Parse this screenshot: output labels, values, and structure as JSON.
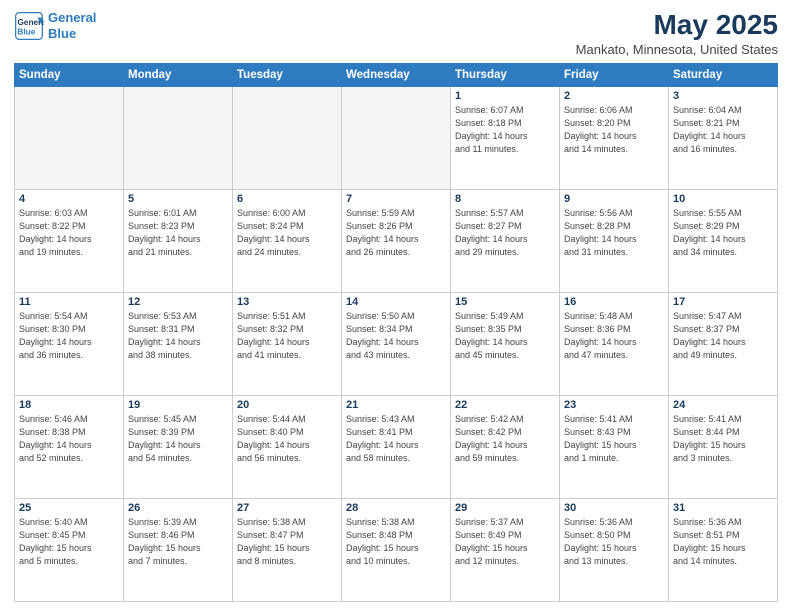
{
  "logo": {
    "line1": "General",
    "line2": "Blue"
  },
  "header": {
    "title": "May 2025",
    "subtitle": "Mankato, Minnesota, United States"
  },
  "weekdays": [
    "Sunday",
    "Monday",
    "Tuesday",
    "Wednesday",
    "Thursday",
    "Friday",
    "Saturday"
  ],
  "weeks": [
    [
      {
        "day": "",
        "info": ""
      },
      {
        "day": "",
        "info": ""
      },
      {
        "day": "",
        "info": ""
      },
      {
        "day": "",
        "info": ""
      },
      {
        "day": "1",
        "info": "Sunrise: 6:07 AM\nSunset: 8:18 PM\nDaylight: 14 hours\nand 11 minutes."
      },
      {
        "day": "2",
        "info": "Sunrise: 6:06 AM\nSunset: 8:20 PM\nDaylight: 14 hours\nand 14 minutes."
      },
      {
        "day": "3",
        "info": "Sunrise: 6:04 AM\nSunset: 8:21 PM\nDaylight: 14 hours\nand 16 minutes."
      }
    ],
    [
      {
        "day": "4",
        "info": "Sunrise: 6:03 AM\nSunset: 8:22 PM\nDaylight: 14 hours\nand 19 minutes."
      },
      {
        "day": "5",
        "info": "Sunrise: 6:01 AM\nSunset: 8:23 PM\nDaylight: 14 hours\nand 21 minutes."
      },
      {
        "day": "6",
        "info": "Sunrise: 6:00 AM\nSunset: 8:24 PM\nDaylight: 14 hours\nand 24 minutes."
      },
      {
        "day": "7",
        "info": "Sunrise: 5:59 AM\nSunset: 8:26 PM\nDaylight: 14 hours\nand 26 minutes."
      },
      {
        "day": "8",
        "info": "Sunrise: 5:57 AM\nSunset: 8:27 PM\nDaylight: 14 hours\nand 29 minutes."
      },
      {
        "day": "9",
        "info": "Sunrise: 5:56 AM\nSunset: 8:28 PM\nDaylight: 14 hours\nand 31 minutes."
      },
      {
        "day": "10",
        "info": "Sunrise: 5:55 AM\nSunset: 8:29 PM\nDaylight: 14 hours\nand 34 minutes."
      }
    ],
    [
      {
        "day": "11",
        "info": "Sunrise: 5:54 AM\nSunset: 8:30 PM\nDaylight: 14 hours\nand 36 minutes."
      },
      {
        "day": "12",
        "info": "Sunrise: 5:53 AM\nSunset: 8:31 PM\nDaylight: 14 hours\nand 38 minutes."
      },
      {
        "day": "13",
        "info": "Sunrise: 5:51 AM\nSunset: 8:32 PM\nDaylight: 14 hours\nand 41 minutes."
      },
      {
        "day": "14",
        "info": "Sunrise: 5:50 AM\nSunset: 8:34 PM\nDaylight: 14 hours\nand 43 minutes."
      },
      {
        "day": "15",
        "info": "Sunrise: 5:49 AM\nSunset: 8:35 PM\nDaylight: 14 hours\nand 45 minutes."
      },
      {
        "day": "16",
        "info": "Sunrise: 5:48 AM\nSunset: 8:36 PM\nDaylight: 14 hours\nand 47 minutes."
      },
      {
        "day": "17",
        "info": "Sunrise: 5:47 AM\nSunset: 8:37 PM\nDaylight: 14 hours\nand 49 minutes."
      }
    ],
    [
      {
        "day": "18",
        "info": "Sunrise: 5:46 AM\nSunset: 8:38 PM\nDaylight: 14 hours\nand 52 minutes."
      },
      {
        "day": "19",
        "info": "Sunrise: 5:45 AM\nSunset: 8:39 PM\nDaylight: 14 hours\nand 54 minutes."
      },
      {
        "day": "20",
        "info": "Sunrise: 5:44 AM\nSunset: 8:40 PM\nDaylight: 14 hours\nand 56 minutes."
      },
      {
        "day": "21",
        "info": "Sunrise: 5:43 AM\nSunset: 8:41 PM\nDaylight: 14 hours\nand 58 minutes."
      },
      {
        "day": "22",
        "info": "Sunrise: 5:42 AM\nSunset: 8:42 PM\nDaylight: 14 hours\nand 59 minutes."
      },
      {
        "day": "23",
        "info": "Sunrise: 5:41 AM\nSunset: 8:43 PM\nDaylight: 15 hours\nand 1 minute."
      },
      {
        "day": "24",
        "info": "Sunrise: 5:41 AM\nSunset: 8:44 PM\nDaylight: 15 hours\nand 3 minutes."
      }
    ],
    [
      {
        "day": "25",
        "info": "Sunrise: 5:40 AM\nSunset: 8:45 PM\nDaylight: 15 hours\nand 5 minutes."
      },
      {
        "day": "26",
        "info": "Sunrise: 5:39 AM\nSunset: 8:46 PM\nDaylight: 15 hours\nand 7 minutes."
      },
      {
        "day": "27",
        "info": "Sunrise: 5:38 AM\nSunset: 8:47 PM\nDaylight: 15 hours\nand 8 minutes."
      },
      {
        "day": "28",
        "info": "Sunrise: 5:38 AM\nSunset: 8:48 PM\nDaylight: 15 hours\nand 10 minutes."
      },
      {
        "day": "29",
        "info": "Sunrise: 5:37 AM\nSunset: 8:49 PM\nDaylight: 15 hours\nand 12 minutes."
      },
      {
        "day": "30",
        "info": "Sunrise: 5:36 AM\nSunset: 8:50 PM\nDaylight: 15 hours\nand 13 minutes."
      },
      {
        "day": "31",
        "info": "Sunrise: 5:36 AM\nSunset: 8:51 PM\nDaylight: 15 hours\nand 14 minutes."
      }
    ]
  ]
}
